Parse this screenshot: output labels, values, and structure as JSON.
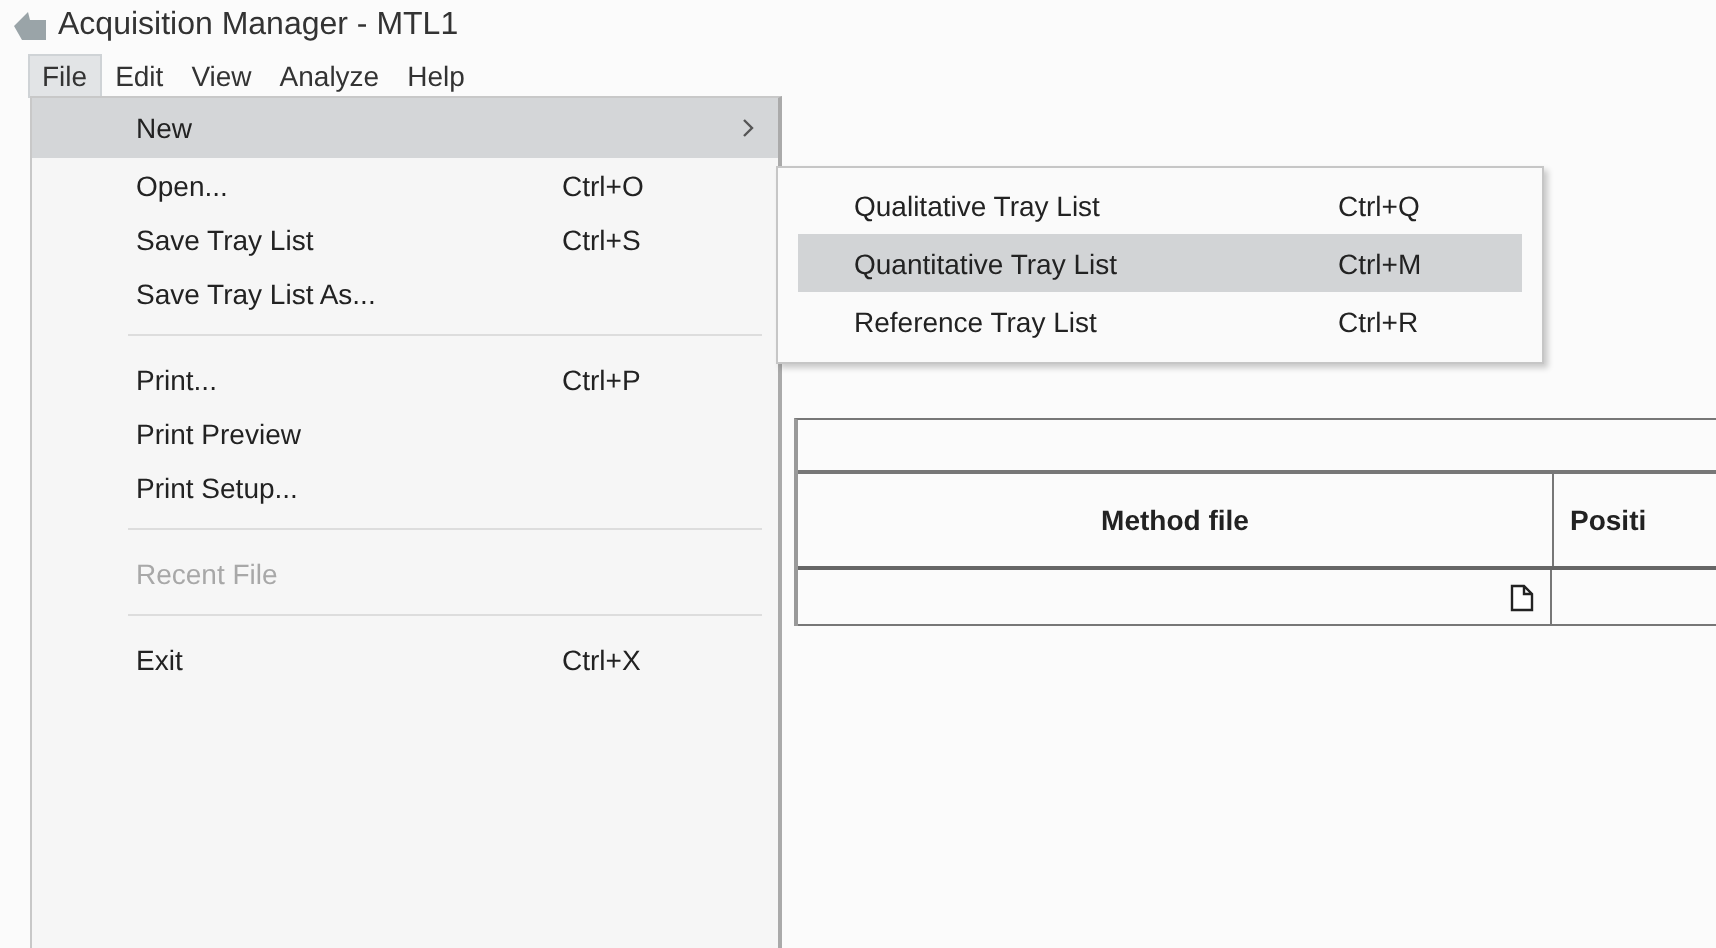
{
  "window": {
    "title": "Acquisition Manager - MTL1"
  },
  "menu_bar": [
    {
      "label": "File",
      "selected": true
    },
    {
      "label": "Edit",
      "selected": false
    },
    {
      "label": "View",
      "selected": false
    },
    {
      "label": "Analyze",
      "selected": false
    },
    {
      "label": "Help",
      "selected": false
    }
  ],
  "file_menu": [
    {
      "kind": "submenu",
      "label": "New",
      "selected": true,
      "disabled": false
    },
    {
      "kind": "item",
      "label": "Open...",
      "shortcut": "Ctrl+O",
      "selected": false,
      "disabled": false
    },
    {
      "kind": "item",
      "label": "Save Tray List",
      "shortcut": "Ctrl+S",
      "selected": false,
      "disabled": false
    },
    {
      "kind": "item",
      "label": "Save Tray List As...",
      "selected": false,
      "disabled": false
    },
    {
      "kind": "separator"
    },
    {
      "kind": "item",
      "label": "Print...",
      "shortcut": "Ctrl+P",
      "selected": false,
      "disabled": false
    },
    {
      "kind": "item",
      "label": "Print Preview",
      "selected": false,
      "disabled": false
    },
    {
      "kind": "item",
      "label": "Print Setup...",
      "selected": false,
      "disabled": false
    },
    {
      "kind": "separator"
    },
    {
      "kind": "item",
      "label": "Recent File",
      "selected": false,
      "disabled": true
    },
    {
      "kind": "separator"
    },
    {
      "kind": "item",
      "label": "Exit",
      "shortcut": "Ctrl+X",
      "selected": false,
      "disabled": false
    }
  ],
  "new_submenu": [
    {
      "label": "Qualitative Tray List",
      "shortcut": "Ctrl+Q",
      "selected": false
    },
    {
      "label": "Quantitative Tray List",
      "shortcut": "Ctrl+M",
      "selected": true
    },
    {
      "label": "Reference Tray List",
      "shortcut": "Ctrl+R",
      "selected": false
    }
  ],
  "table": {
    "columns": [
      "Method file",
      "Positi"
    ]
  }
}
